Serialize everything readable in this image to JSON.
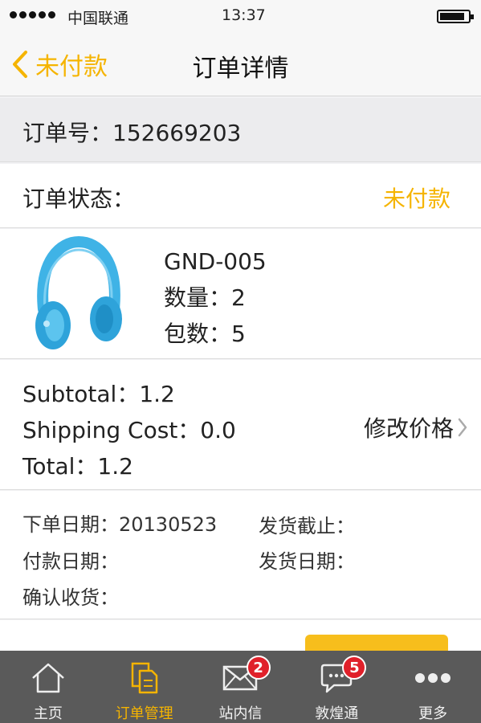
{
  "status_bar": {
    "carrier": "中国联通",
    "time": "13:37"
  },
  "nav": {
    "back_label": "未付款",
    "title": "订单详情"
  },
  "order": {
    "number_text": "订单号：152669203"
  },
  "status": {
    "label": "订单状态：",
    "value": "未付款",
    "value_color": "#f5b400"
  },
  "product": {
    "image_icon": "headphones-image",
    "model": "GND-005",
    "quantity": "数量：2",
    "packages": "包数：5"
  },
  "pricing": {
    "subtotal": "Subtotal：1.2",
    "shipping": "Shipping Cost：0.0",
    "total": "Total：1.2",
    "edit_label": "修改价格"
  },
  "dates": {
    "order_date": "下单日期：20130523",
    "ship_deadline": "发货截止：",
    "pay_date": "付款日期：",
    "ship_date": "发货日期：",
    "confirm_receipt": "确认收货："
  },
  "tabs": [
    {
      "label": "主页",
      "icon": "home-icon"
    },
    {
      "label": "订单管理",
      "icon": "orders-icon",
      "active": true
    },
    {
      "label": "站内信",
      "icon": "mail-icon",
      "badge": "2"
    },
    {
      "label": "敦煌通",
      "icon": "chat-icon",
      "badge": "5"
    },
    {
      "label": "更多",
      "icon": "more-icon"
    }
  ],
  "colors": {
    "accent": "#f5b400",
    "tab_bar": "#5a5a5a",
    "badge": "#e0202a"
  }
}
